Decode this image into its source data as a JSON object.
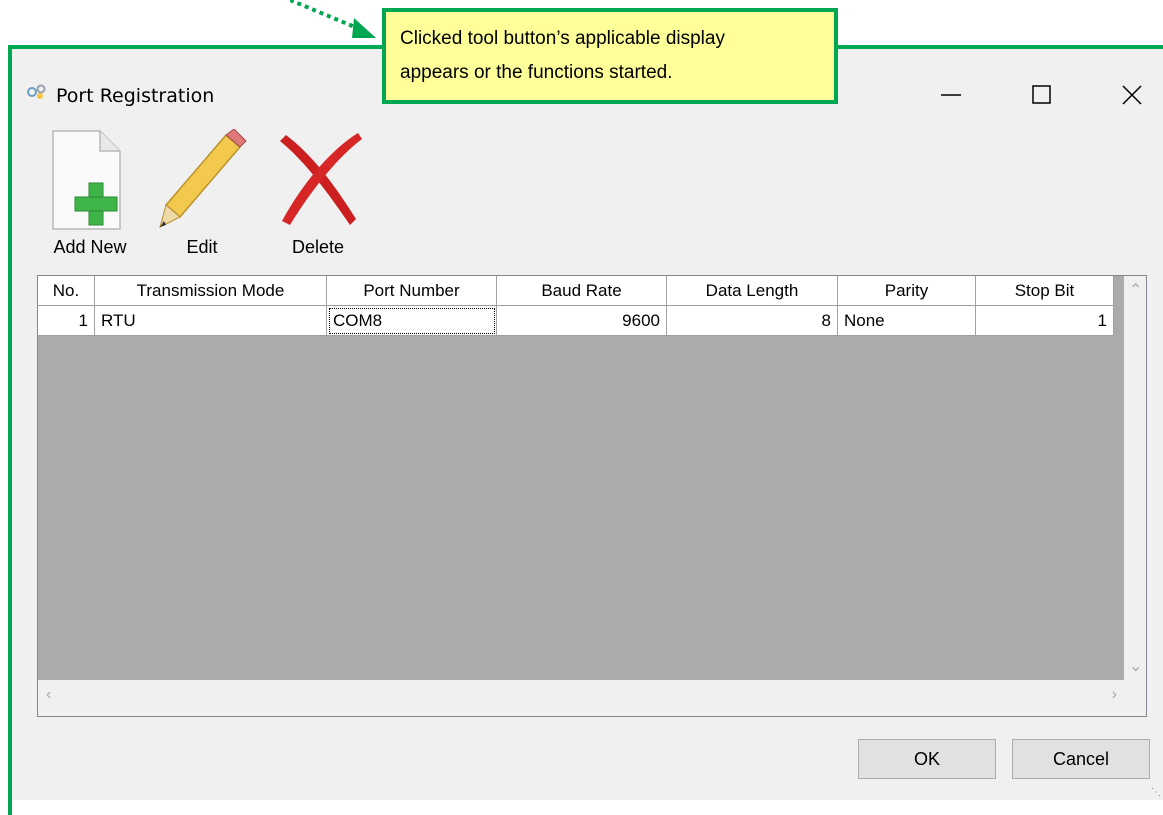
{
  "callout": {
    "line1": "Clicked tool button’s applicable display",
    "line2": "appears or the functions started."
  },
  "window": {
    "title": "Port Registration",
    "icons": {
      "app": "port-registration-icon",
      "minimize": "minimize-icon",
      "maximize": "maximize-icon",
      "close": "close-icon"
    }
  },
  "toolbar": {
    "add_label": "Add New",
    "edit_label": "Edit",
    "delete_label": "Delete",
    "icons": {
      "add": "add-new-icon",
      "edit": "pencil-icon",
      "delete": "red-x-icon"
    }
  },
  "grid": {
    "columns": [
      "No.",
      "Transmission Mode",
      "Port Number",
      "Baud Rate",
      "Data Length",
      "Parity",
      "Stop Bit"
    ],
    "rows": [
      {
        "no": "1",
        "mode": "RTU",
        "port": "COM8",
        "baud": "9600",
        "length": "8",
        "parity": "None",
        "stop": "1"
      }
    ]
  },
  "buttons": {
    "ok": "OK",
    "cancel": "Cancel"
  },
  "colors": {
    "annotation_green": "#00a651",
    "callout_yellow": "#ffff99",
    "grid_empty": "#ababab"
  }
}
